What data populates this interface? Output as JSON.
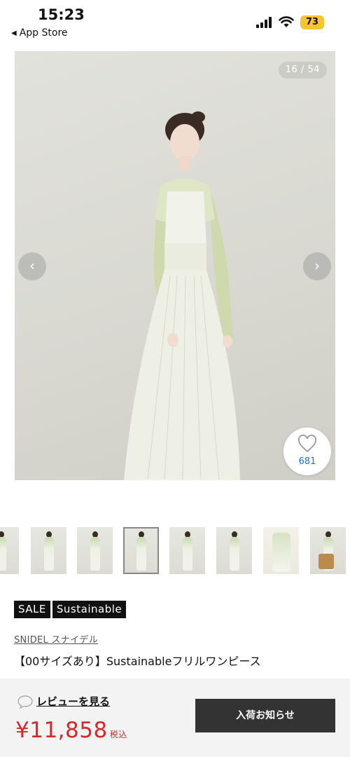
{
  "status_bar": {
    "time": "15:23",
    "back_label": "App Store",
    "battery": "73"
  },
  "gallery": {
    "counter": "16 / 54",
    "prev_arrow": "‹",
    "next_arrow": "›",
    "favorite_count": "681",
    "thumbnail_count": 8
  },
  "product": {
    "tags": [
      "SALE",
      "Sustainable"
    ],
    "brand": "SNIDEL  スナイデル",
    "name": "【00サイズあり】Sustainableフリルワンピース"
  },
  "purchase_bar": {
    "review_link": "レビューを見る",
    "price": "¥11,858",
    "tax_label": "税込",
    "notify_button": "入荷お知らせ"
  },
  "colors": {
    "price": "#d5282a",
    "favorite_count": "#1f6fc9",
    "notify_button_bg": "#333333",
    "battery": "#f7c530"
  }
}
